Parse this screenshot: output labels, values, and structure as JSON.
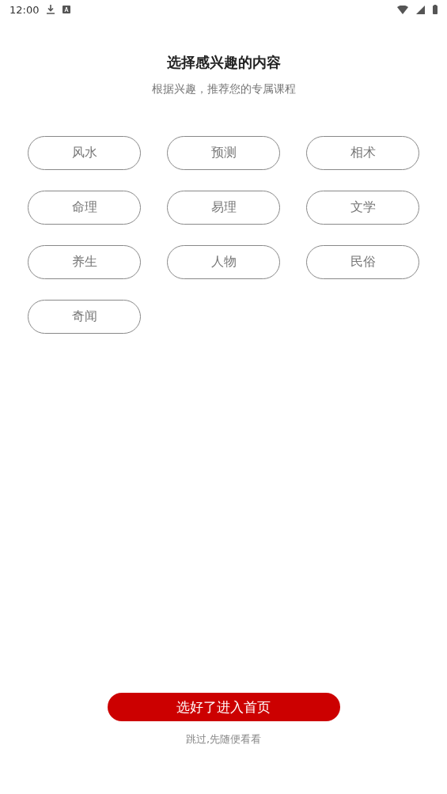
{
  "status_bar": {
    "time": "12:00"
  },
  "title": "选择感兴趣的内容",
  "subtitle": "根据兴趣，推荐您的专属课程",
  "tags": [
    {
      "label": "风水",
      "selected": false
    },
    {
      "label": "预测",
      "selected": false
    },
    {
      "label": "相术",
      "selected": false
    },
    {
      "label": "命理",
      "selected": false
    },
    {
      "label": "易理",
      "selected": false
    },
    {
      "label": "文学",
      "selected": false
    },
    {
      "label": "养生",
      "selected": false
    },
    {
      "label": "人物",
      "selected": false
    },
    {
      "label": "民俗",
      "selected": false
    },
    {
      "label": "奇闻",
      "selected": false
    }
  ],
  "confirm_button": "选好了进入首页",
  "skip_link": "跳过,先随便看看"
}
